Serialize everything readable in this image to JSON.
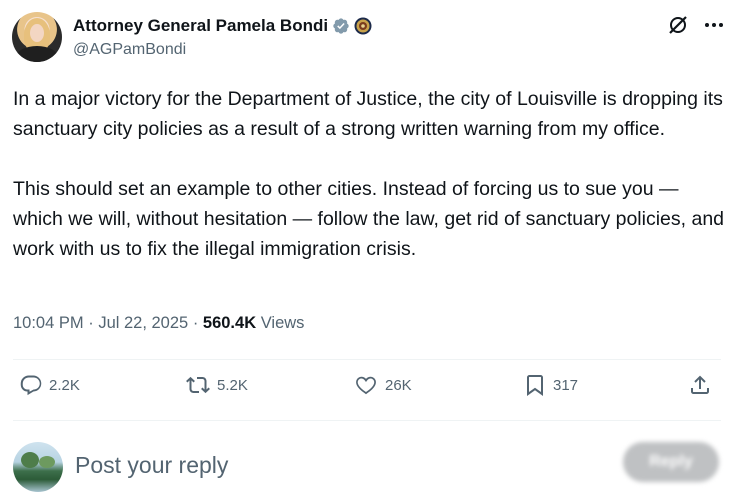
{
  "author": {
    "name": "Attorney General Pamela Bondi",
    "handle": "@AGPamBondi",
    "verified_color": "#829aab",
    "icons": [
      "verified-badge-icon",
      "doj-seal-icon"
    ]
  },
  "header_actions": {
    "icons": [
      "grok-icon",
      "more-options-icon"
    ]
  },
  "tweet": {
    "paragraph_1": "In a major victory for the Department of Justice, the city of Louisville is dropping its sanctuary city policies as a result of a strong written warning from my office.",
    "paragraph_2": "This should set an example to other cities. Instead of forcing us to sue you — which we will, without hesitation — follow the law, get rid of sanctuary policies, and work with us to fix the illegal immigration crisis."
  },
  "meta": {
    "time": "10:04 PM",
    "separator": "·",
    "date": "Jul 22, 2025",
    "views_count": "560.4K",
    "views_label": "Views"
  },
  "engagement": {
    "replies": "2.2K",
    "reposts": "5.2K",
    "likes": "26K",
    "bookmarks": "317",
    "icons": [
      "reply-icon",
      "repost-icon",
      "like-icon",
      "bookmark-icon",
      "share-icon"
    ]
  },
  "reply": {
    "placeholder": "Post your reply",
    "button_label": "Reply"
  },
  "colors": {
    "text_primary": "#0f1419",
    "text_secondary": "#536471",
    "divider": "#eff3f4",
    "reply_button_disabled": "#bfc1c3"
  }
}
